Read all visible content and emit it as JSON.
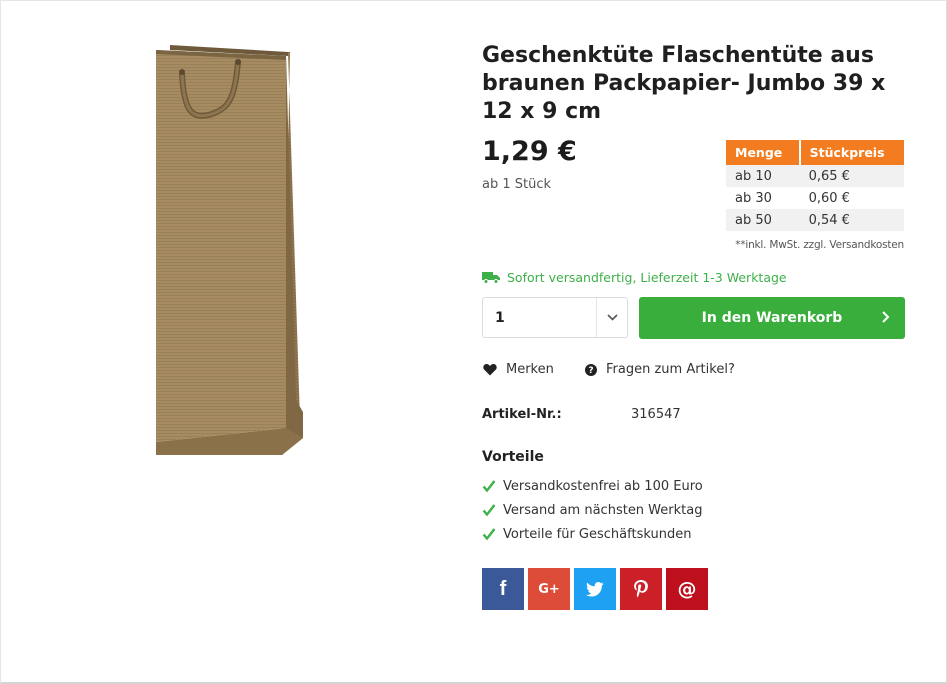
{
  "product": {
    "title": "Geschenktüte Flaschentüte aus braunen Packpapier- Jumbo 39 x 12 x 9 cm",
    "price": "1,29 €",
    "unit_note": "ab 1 Stück"
  },
  "tier_table": {
    "headers": [
      "Menge",
      "Stückpreis"
    ],
    "rows": [
      [
        "ab 10",
        "0,65 €"
      ],
      [
        "ab 30",
        "0,60 €"
      ],
      [
        "ab 50",
        "0,54 €"
      ]
    ]
  },
  "vat_note": "**inkl. MwSt. zzgl. Versandkosten",
  "shipping": {
    "text": "Sofort versandfertig, Lieferzeit 1-3 Werktage",
    "icon": "truck-icon",
    "color": "#3db04a"
  },
  "quantity": {
    "value": "1"
  },
  "cart": {
    "label": "In den Warenkorb",
    "color": "#3aae3c"
  },
  "actions": {
    "bookmark_label": "Merken",
    "ask_label": "Fragen zum Artikel?"
  },
  "specs": {
    "article_no_label": "Artikel-Nr.:",
    "article_no_value": "316547"
  },
  "benefits": {
    "heading": "Vorteile",
    "items": [
      "Versandkostenfrei ab 100 Euro",
      "Versand am nächsten Werktag",
      "Vorteile für Geschäftskunden"
    ]
  },
  "share": {
    "facebook_label": "f",
    "googleplus_label": "G+",
    "email_label": "@",
    "colors": {
      "facebook": "#3b5998",
      "googleplus": "#dd4b39",
      "twitter": "#1ea1f2",
      "pinterest": "#cb2027",
      "email": "#bd0f1c"
    }
  },
  "accent_colors": {
    "tier_header": "#f47c20",
    "check": "#3db04a"
  }
}
